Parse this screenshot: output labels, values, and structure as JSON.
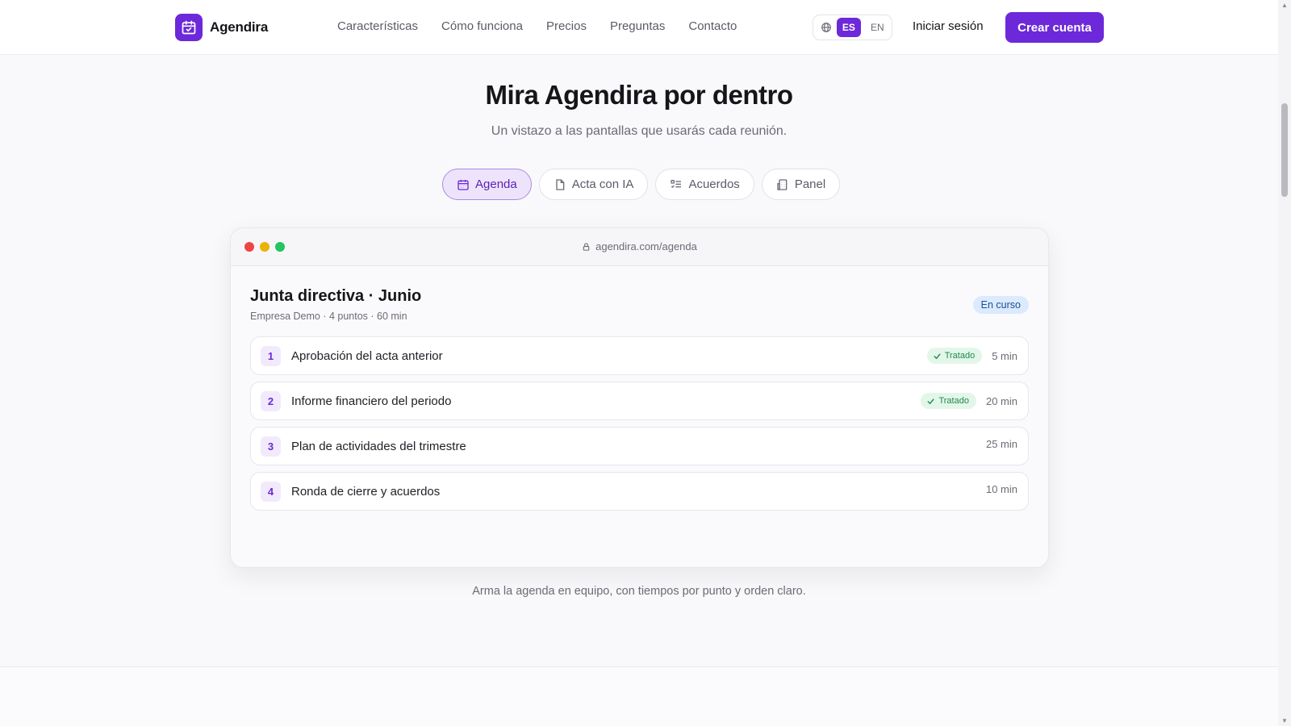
{
  "brand": {
    "name": "Agendira",
    "icon": "calendar-check-icon",
    "color": "#6d28d9"
  },
  "nav": [
    "Características",
    "Cómo funciona",
    "Precios",
    "Preguntas",
    "Contacto"
  ],
  "language": {
    "icon": "globe-icon",
    "active": "ES",
    "inactive": "EN"
  },
  "header": {
    "login_label": "Iniciar sesión",
    "cta_label": "Crear cuenta"
  },
  "hero": {
    "title": "Mira Agendira por dentro",
    "subtitle": "Un vistazo a las pantallas que usarás cada reunión."
  },
  "tabs": [
    {
      "label": "Agenda",
      "icon": "calendar-icon",
      "active": true
    },
    {
      "label": "Acta con IA",
      "icon": "document-icon",
      "active": false
    },
    {
      "label": "Acuerdos",
      "icon": "checklist-icon",
      "active": false
    },
    {
      "label": "Panel",
      "icon": "building-icon",
      "active": false
    }
  ],
  "preview": {
    "url": "agendira.com/agenda",
    "meeting_title": "Junta directiva · Junio",
    "meeting_meta": "Empresa Demo · 4 puntos · 60 min",
    "status": "En curso",
    "items": [
      {
        "number": "1",
        "title": "Aprobación del acta anterior",
        "done": true,
        "done_label": "Tratado",
        "duration": "5 min"
      },
      {
        "number": "2",
        "title": "Informe financiero del periodo",
        "done": true,
        "done_label": "Tratado",
        "duration": "20 min"
      },
      {
        "number": "3",
        "title": "Plan de actividades del trimestre",
        "done": false,
        "done_label": "",
        "duration": "25 min"
      },
      {
        "number": "4",
        "title": "Ronda de cierre y acuerdos",
        "done": false,
        "done_label": "",
        "duration": "10 min"
      }
    ]
  },
  "caption": "Arma la agenda en equipo, con tiempos por punto y orden claro.",
  "colors": {
    "accent": "#6d28d9",
    "status_bg": "#dbeafe",
    "done_bg": "#e3f6ea",
    "done_text": "#1f8a4c"
  }
}
